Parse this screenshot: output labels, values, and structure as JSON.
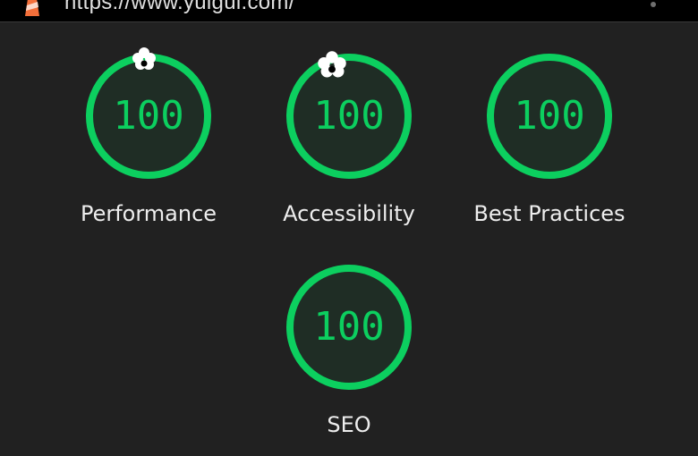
{
  "browser": {
    "url": "https://www.yuigui.com/",
    "logo_icon": "lighthouse-icon",
    "menu_icon": "kebab-menu-icon"
  },
  "gauges": [
    {
      "label": "Performance",
      "score": "100",
      "value": 100
    },
    {
      "label": "Accessibility",
      "score": "100",
      "value": 100
    },
    {
      "label": "Best Practices",
      "score": "100",
      "value": 100
    },
    {
      "label": "SEO",
      "score": "100",
      "value": 100
    }
  ],
  "colors": {
    "pass": "#0ccf5f",
    "background": "#212121",
    "gauge_fill": "#1f2d25"
  },
  "decorations": {
    "fireworks_icon": "fireworks-icon"
  }
}
